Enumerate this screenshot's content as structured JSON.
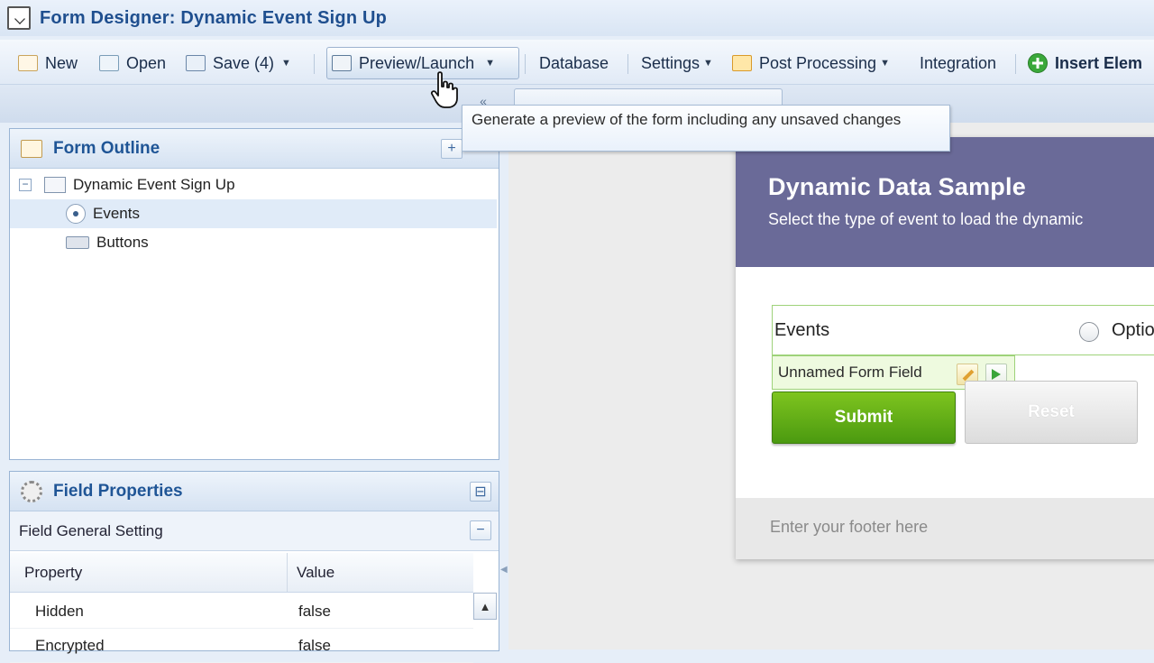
{
  "window": {
    "title": "Form Designer: Dynamic Event Sign Up"
  },
  "toolbar": {
    "new_label": "New",
    "open_label": "Open",
    "save_label": "Save (4)",
    "preview_label": "Preview/Launch",
    "database_label": "Database",
    "settings_label": "Settings",
    "post_processing_label": "Post Processing",
    "integration_label": "Integration",
    "insert_label": "Insert Elem"
  },
  "tooltip": {
    "text": "Generate a preview of the form including any unsaved changes"
  },
  "outline": {
    "title": "Form Outline",
    "add_symbol": "+",
    "tree": {
      "root_toggle": "−",
      "root_label": "Dynamic Event Sign Up",
      "items": [
        {
          "label": "Events",
          "selected": true,
          "icon": "radio-icon"
        },
        {
          "label": "Buttons",
          "selected": false,
          "icon": "button-icon"
        }
      ]
    }
  },
  "properties": {
    "title": "Field Properties",
    "pin_symbol": "⊟",
    "section_label": "Field General Setting",
    "section_toggle": "−",
    "columns": {
      "property": "Property",
      "value": "Value"
    },
    "rows": [
      {
        "property": "Hidden",
        "value": "false"
      },
      {
        "property": "Encrypted",
        "value": "false"
      }
    ]
  },
  "form_preview": {
    "title": "Dynamic Data Sample",
    "subtitle": "Select the type of event to load the dynamic",
    "field_label": "Events",
    "option_label": "Option La",
    "field_tag": "Unnamed Form Field",
    "submit_label": "Submit",
    "reset_label": "Reset",
    "footer": "Enter your footer here"
  },
  "colors": {
    "banner": "#6a6a98",
    "submit": "#5aa814",
    "accent": "#1f5596"
  }
}
